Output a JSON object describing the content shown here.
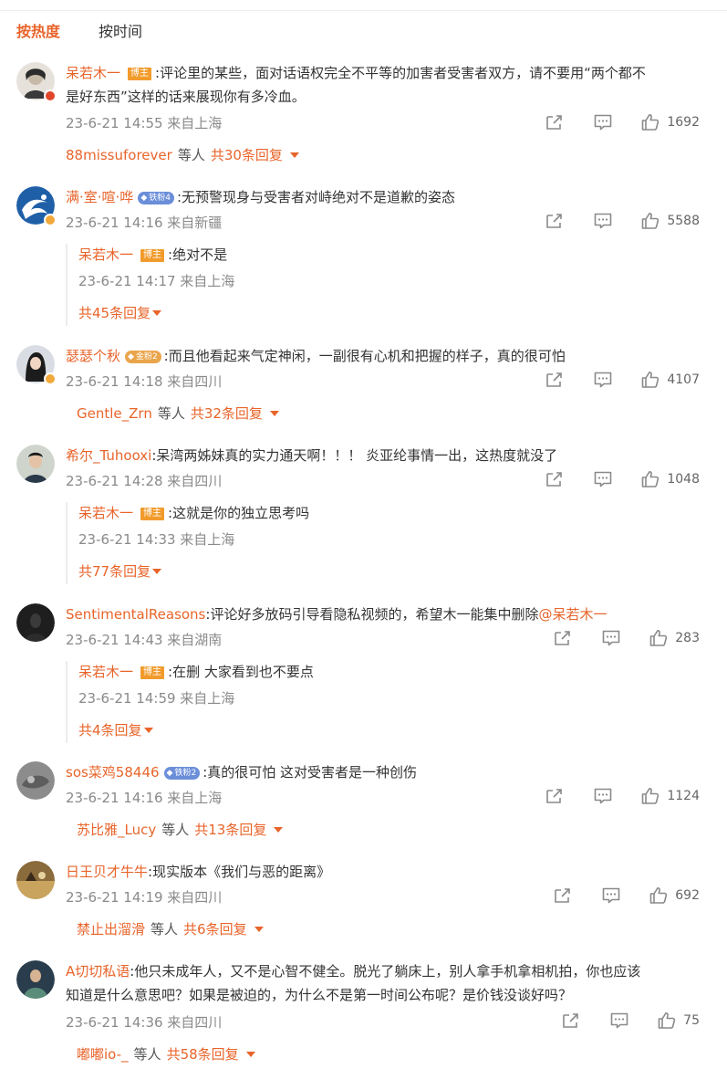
{
  "tabs": {
    "hot": "按热度",
    "time": "按时间"
  },
  "comments": [
    {
      "user": "呆若木一",
      "badge": "博主",
      "text_line1": ":评论里的某些，面对话语权完全不平等的加害者受害者双方，请不要用“两个都不",
      "text_line2": "是好东西”这样的话来展现你有多冷血。",
      "time": "23-6-21 14:55 来自上海",
      "likes": "1692",
      "reply_user": "88missuforever",
      "reply_etc": "等人",
      "reply_count": "共30条回复"
    },
    {
      "user": "满·室·喧·哗",
      "fan_badge": "铁粉4",
      "text_line1": ":无预警现身与受害者对峙绝对不是道歉的姿态",
      "time": "23-6-21 14:16 来自新疆",
      "likes": "5588",
      "sub_user": "呆若木一",
      "sub_badge": "博主",
      "sub_text": ":绝对不是",
      "sub_time": "23-6-21 14:17 来自上海",
      "sub_count": "共45条回复"
    },
    {
      "user": "瑟瑟个秋",
      "fan_badge": "金粉2",
      "text_line1": ":而且他看起来气定神闲，一副很有心机和把握的样子，真的很可怕",
      "time": "23-6-21 14:18 来自四川",
      "likes": "4107",
      "reply_user": "Gentle_Zrn",
      "reply_etc": "等人",
      "reply_count": "共32条回复"
    },
    {
      "user": "希尔_Tuhooxi",
      "text_line1": ":呆湾两姊妹真的实力通天啊！！！ 炎亚纶事情一出，这热度就没了",
      "time": "23-6-21 14:28 来自四川",
      "likes": "1048",
      "sub_user": "呆若木一",
      "sub_badge": "博主",
      "sub_text": ":这就是你的独立思考吗",
      "sub_time": "23-6-21 14:33 来自上海",
      "sub_count": "共77条回复"
    },
    {
      "user": "SentimentalReasons",
      "text_line1": ":评论好多放码引导看隐私视频的，希望木一能集中删除",
      "mention": "@呆若木一",
      "time": "23-6-21 14:43 来自湖南",
      "likes": "283",
      "sub_user": "呆若木一",
      "sub_badge": "博主",
      "sub_text": ":在删 大家看到也不要点",
      "sub_time": "23-6-21 14:59 来自上海",
      "sub_count": "共4条回复"
    },
    {
      "user": "sos菜鸡58446",
      "fan_badge": "铁粉2",
      "text_line1": ":真的很可怕 这对受害者是一种创伤",
      "time": "23-6-21 14:16 来自上海",
      "likes": "1124",
      "reply_user": "苏比雅_Lucy",
      "reply_etc": "等人",
      "reply_count": "共13条回复"
    },
    {
      "user": "日王贝才牛牛",
      "text_line1": ":现实版本《我们与恶的距离》",
      "time": "23-6-21 14:19 来自四川",
      "likes": "692",
      "reply_user": "禁止出溜滑",
      "reply_etc": "等人",
      "reply_count": "共6条回复"
    },
    {
      "user": "A切切私语",
      "text_line1": ":他只未成年人，又不是心智不健全。脱光了躺床上，别人拿手机拿相机拍，你也应该",
      "text_line2": "知道是什么意思吧？如果是被迫的，为什么不是第一时间公布呢？是价钱没谈好吗？",
      "time": "23-6-21 14:36 来自四川",
      "likes": "75",
      "reply_user": "嘟嘟io-_",
      "reply_etc": "等人",
      "reply_count": "共58条回复"
    }
  ],
  "icons": {
    "share": "share-icon",
    "comment": "comment-icon",
    "like": "like-icon"
  },
  "colors": {
    "accent": "#e8642a",
    "host_badge": "#f19b2c",
    "meta": "#8a8a8a"
  }
}
